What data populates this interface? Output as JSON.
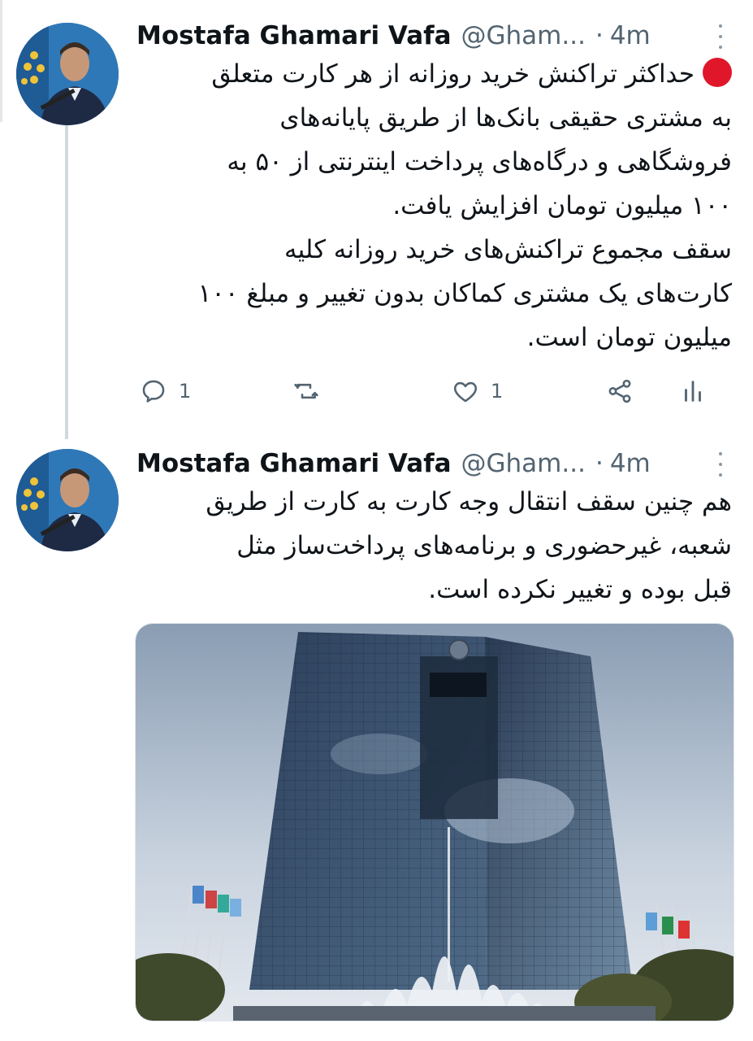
{
  "tweets": [
    {
      "author_name": "Mostafa Ghamari Vafa",
      "handle": "@Gham...",
      "separator": "·",
      "time": "4m",
      "emoji": "red-circle",
      "text_lines": [
        "حداکثر تراکنش خرید روزانه از هر کارت متعلق",
        "به مشتری حقیقی بانک‌ها از طریق پایانه‌های",
        "فروشگاهی و درگاه‌های پرداخت اینترنتی از ۵۰ به",
        "۱۰۰ میلیون تومان افزایش یافت.",
        "سقف مجموع تراکنش‌های خرید روزانه کلیه",
        "کارت‌های یک مشتری کماکان بدون تغییر و مبلغ ۱۰۰",
        "میلیون تومان است."
      ],
      "reply_count": "1",
      "retweet_count": "",
      "like_count": "1"
    },
    {
      "author_name": "Mostafa Ghamari Vafa",
      "handle": "@Gham...",
      "separator": "·",
      "time": "4m",
      "text_lines": [
        "هم چنین سقف انتقال وجه کارت به کارت از طریق",
        "شعبه، غیرحضوری و برنامه‌های پرداخت‌ساز مثل",
        "قبل بوده و تغییر نکرده است."
      ],
      "media": "central-bank-building-photo"
    }
  ],
  "icons": [
    "more-icon",
    "reply-icon",
    "retweet-icon",
    "like-icon",
    "share-icon",
    "analytics-icon"
  ],
  "colors": {
    "text": "#0f1419",
    "muted": "#536471",
    "thread_line": "#cfd9de",
    "red_circle": "#e0162b"
  }
}
